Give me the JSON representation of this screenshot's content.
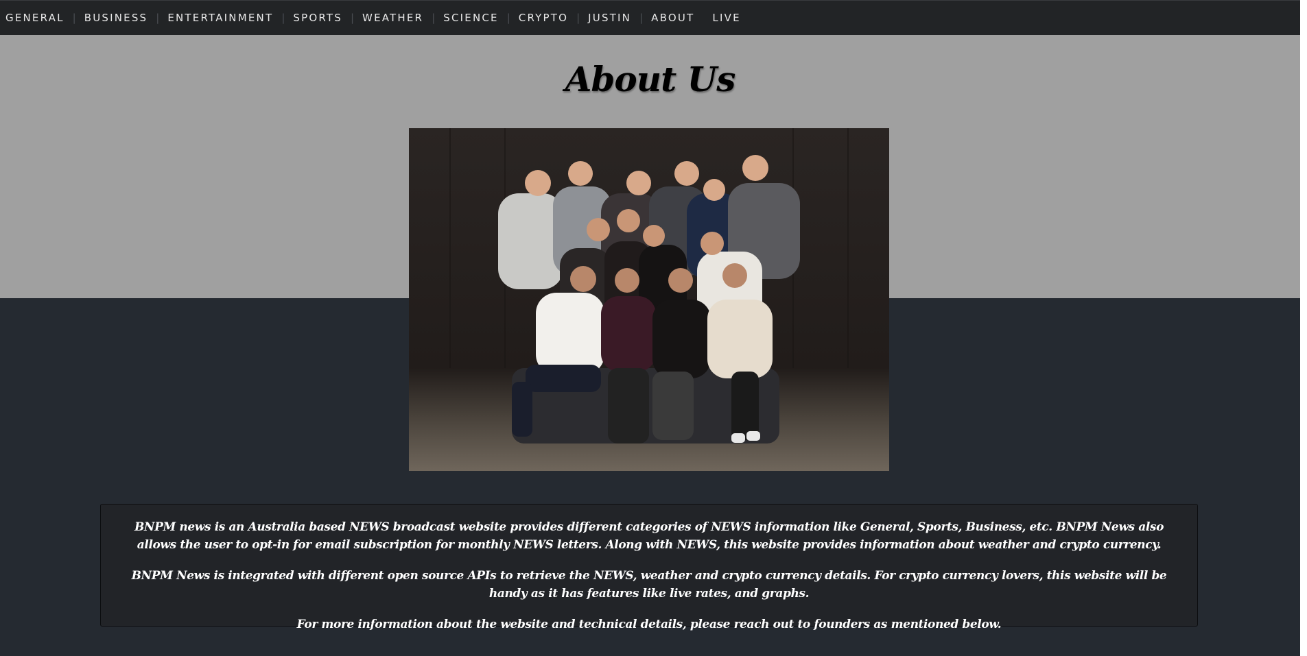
{
  "nav": {
    "items": [
      {
        "label": "GENERAL"
      },
      {
        "label": "BUSINESS"
      },
      {
        "label": "ENTERTAINMENT"
      },
      {
        "label": "SPORTS"
      },
      {
        "label": "WEATHER"
      },
      {
        "label": "SCIENCE"
      },
      {
        "label": "CRYPTO"
      },
      {
        "label": "JUSTIN"
      },
      {
        "label": "ABOUT"
      },
      {
        "label": "LIVE"
      }
    ],
    "separator": "|"
  },
  "page": {
    "title": "About Us",
    "photo_icon": "team-group-photo"
  },
  "about": {
    "paragraphs": [
      "BNPM news is an Australia based NEWS broadcast website provides different categories of NEWS information like General, Sports, Business, etc. BNPM News also allows the user to opt-in for email subscription for monthly NEWS letters. Along with NEWS, this website provides information about weather and crypto currency.",
      "BNPM News is integrated with different open source APIs to retrieve the NEWS, weather and crypto currency details. For crypto currency lovers, this website will be handy as it has features like live rates, and graphs.",
      "For more information about the website and technical details, please reach out to founders as mentioned below."
    ]
  },
  "colors": {
    "navbar_bg": "#222426",
    "hero_bg": "#a0a0a0",
    "page_bg": "#252a31",
    "box_bg": "#222428"
  }
}
